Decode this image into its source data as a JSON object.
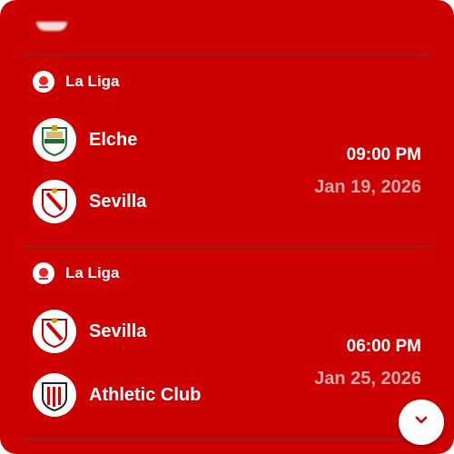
{
  "matches": [
    {
      "league": "La Liga",
      "home_team": "Elche",
      "away_team": "Sevilla",
      "time": "09:00 PM",
      "date": "Jan 19, 2026"
    },
    {
      "league": "La Liga",
      "home_team": "Sevilla",
      "away_team": "Athletic Club",
      "time": "06:00 PM",
      "date": "Jan 25, 2026"
    }
  ],
  "icons": {
    "league": "la-liga-logo-icon",
    "scroll": "chevron-down-icon"
  },
  "colors": {
    "background": "#cc0000",
    "divider": "#9e1b1b",
    "date_text": "#e8a7a7",
    "text": "#ffffff"
  }
}
